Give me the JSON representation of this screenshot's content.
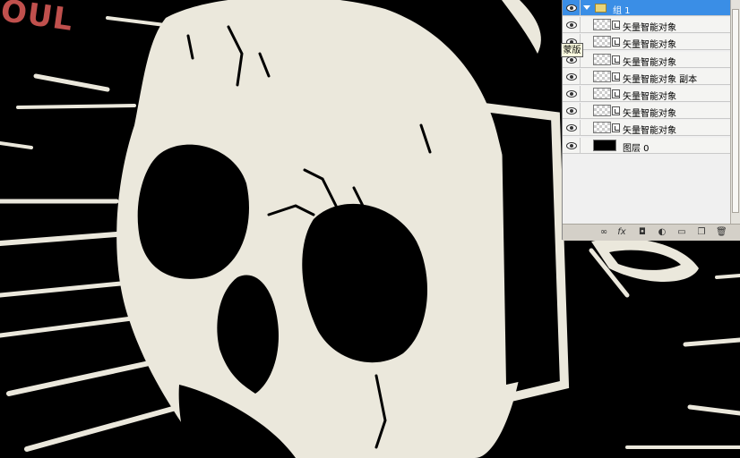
{
  "canvas": {
    "brand_text": "OUL",
    "background_color": "#000000",
    "art_color": "#ebe8dc",
    "brand_color": "#c0504d"
  },
  "layers_panel": {
    "layers": [
      {
        "name": "组 1",
        "type": "group",
        "selected": true,
        "visible": true
      },
      {
        "name": "矢量智能对象",
        "type": "smart-object",
        "visible": true
      },
      {
        "name": "矢量智能对象",
        "type": "smart-object",
        "visible": true
      },
      {
        "name": "矢量智能对象",
        "type": "smart-object",
        "visible": true
      },
      {
        "name": "矢量智能对象 副本",
        "type": "smart-object",
        "visible": true
      },
      {
        "name": "矢量智能对象",
        "type": "smart-object",
        "visible": true
      },
      {
        "name": "矢量智能对象",
        "type": "smart-object",
        "visible": true
      },
      {
        "name": "矢量智能对象",
        "type": "smart-object",
        "visible": true
      },
      {
        "name": "图层 0",
        "type": "layer",
        "visible": true
      }
    ],
    "footer_icons": [
      "link-icon",
      "fx-icon",
      "mask-icon",
      "adjustment-icon",
      "folder-icon",
      "new-layer-icon",
      "trash-icon"
    ],
    "footer_glyphs": {
      "link": "∞",
      "fx": "fx",
      "mask": "◘",
      "adjust": "◐",
      "folder": "▭",
      "new": "❐",
      "trash": "🗑"
    },
    "selected_color": "#3a8ee6"
  },
  "tooltip": {
    "text": "蒙版"
  }
}
